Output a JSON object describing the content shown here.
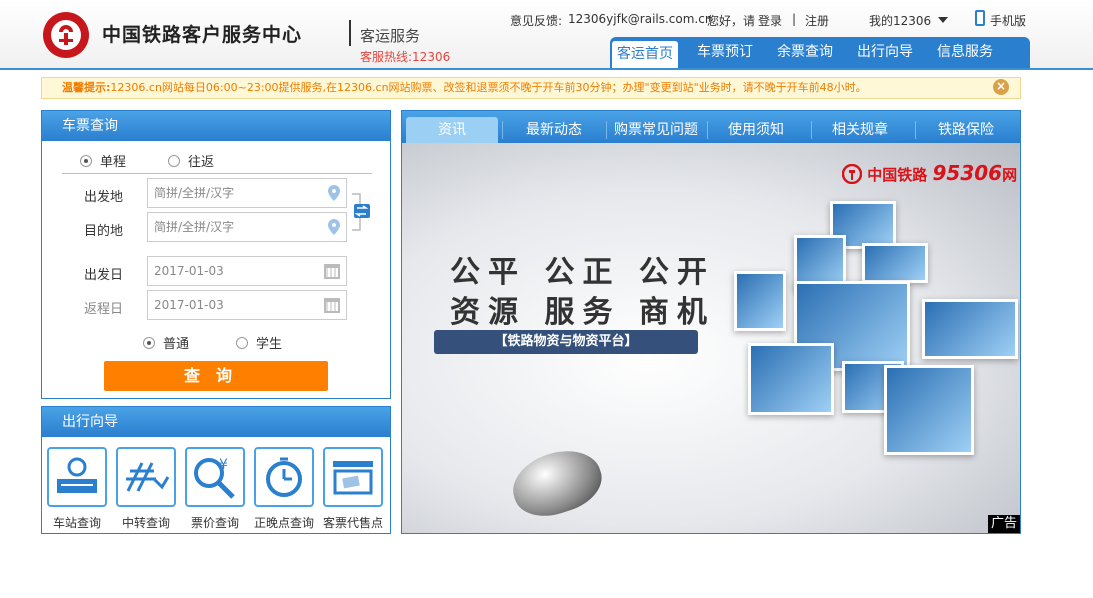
{
  "header": {
    "site_name": "中国铁路客户服务中心",
    "subtitle": "客运服务",
    "hotline": "客服热线:12306",
    "feedback_label": "意见反馈:",
    "feedback_email": "12306yjfk@rails.com.cn",
    "greeting": "您好，请",
    "login": "登录",
    "separator": "|",
    "register": "注册",
    "my12306": "我的12306",
    "mobile": "手机版"
  },
  "nav": {
    "items": [
      "客运首页",
      "车票预订",
      "余票查询",
      "出行向导",
      "信息服务"
    ]
  },
  "notice": {
    "label": "温馨提示:",
    "text": "12306.cn网站每日06:00~23:00提供服务,在12306.cn网站购票、改签和退票须不晚于开车前30分钟；办理\"变更到站\"业务时，请不晚于开车前48小时。"
  },
  "ticket": {
    "title": "车票查询",
    "trip_oneway": "单程",
    "trip_round": "往返",
    "from_label": "出发地",
    "to_label": "目的地",
    "from_placeholder": "简拼/全拼/汉字",
    "to_placeholder": "简拼/全拼/汉字",
    "depart_label": "出发日",
    "return_label": "返程日",
    "depart_date": "2017-01-03",
    "return_date": "2017-01-03",
    "type_normal": "普通",
    "type_student": "学生",
    "query_button": "查询"
  },
  "guide": {
    "title": "出行向导",
    "items": [
      "车站查询",
      "中转查询",
      "票价查询",
      "正晚点查询",
      "客票代售点"
    ]
  },
  "news": {
    "tabs": [
      "资讯",
      "最新动态",
      "购票常见问题",
      "使用须知",
      "相关规章",
      "铁路保险"
    ],
    "banner": {
      "brand_prefix": "中国铁路",
      "brand_number": "95306",
      "brand_suffix": "网",
      "slogan_line1": "公平 公正 公开",
      "slogan_line2": "资源 服务 商机",
      "platform": "【铁路物资与物资平台】",
      "ad_tag": "广告"
    }
  },
  "colors": {
    "brand_blue": "#2a7fcf",
    "accent_orange": "#ff8000",
    "logo_red": "#c8161d"
  }
}
